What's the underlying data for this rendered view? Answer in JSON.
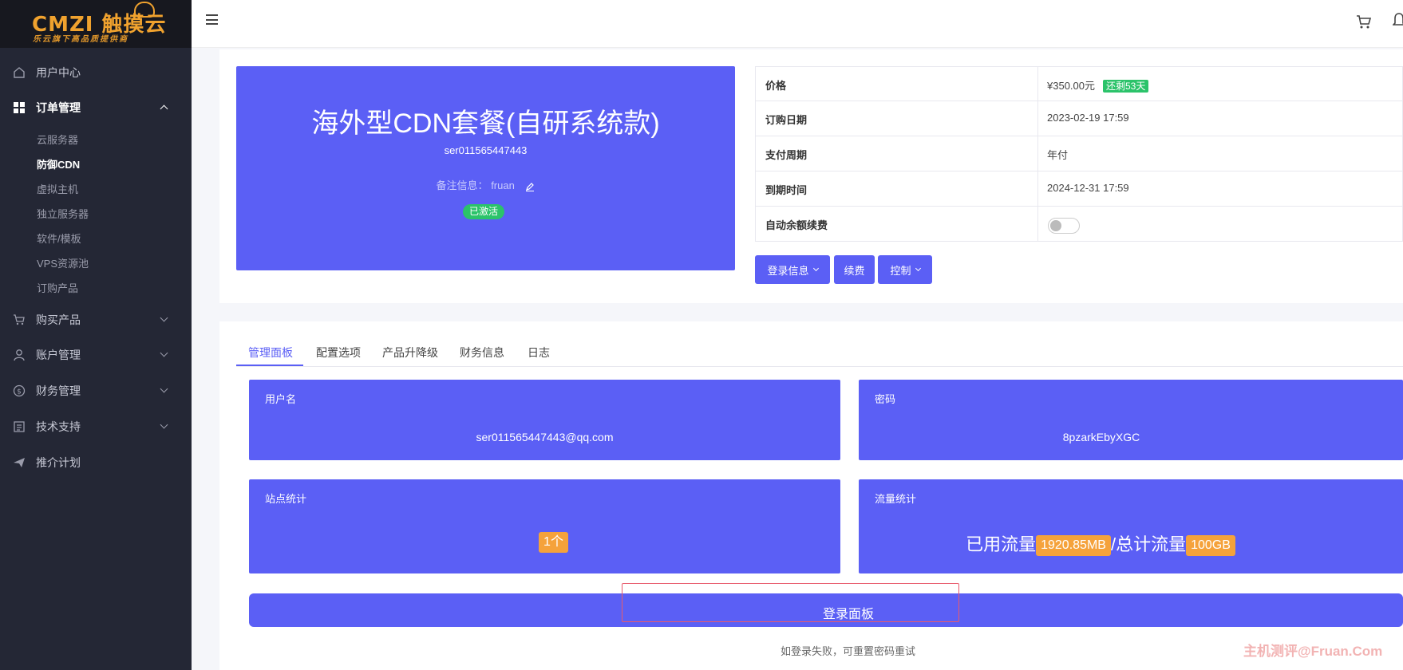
{
  "logo": {
    "brand": "CMZI 触摸云",
    "tagline": "乐云旗下高品质提供商"
  },
  "sidebar": {
    "items": [
      {
        "label": "用户中心",
        "icon": "home-icon"
      },
      {
        "label": "订单管理",
        "icon": "grid-icon",
        "expanded": true,
        "children": [
          "云服务器",
          "防御CDN",
          "虚拟主机",
          "独立服务器",
          "软件/模板",
          "VPS资源池",
          "订购产品"
        ],
        "active_child": "防御CDN"
      },
      {
        "label": "购买产品",
        "icon": "cart-icon"
      },
      {
        "label": "账户管理",
        "icon": "user-icon"
      },
      {
        "label": "财务管理",
        "icon": "dollar-icon"
      },
      {
        "label": "技术支持",
        "icon": "document-icon"
      },
      {
        "label": "推介计划",
        "icon": "paper-plane-icon"
      }
    ]
  },
  "product": {
    "title": "海外型CDN套餐(自研系统款)",
    "id": "ser011565447443",
    "note_label": "备注信息：",
    "note_value": "fruan",
    "status": "已激活"
  },
  "info": {
    "price_label": "价格",
    "price_value": "¥350.00元",
    "remain": "还剩53天",
    "order_date_label": "订购日期",
    "order_date_value": "2023-02-19 17:59",
    "cycle_label": "支付周期",
    "cycle_value": "年付",
    "expire_label": "到期时间",
    "expire_value": "2024-12-31 17:59",
    "auto_renew_label": "自动余额续费",
    "auto_renew_on": false
  },
  "actions": {
    "login_info": "登录信息",
    "renew": "续费",
    "control": "控制"
  },
  "tabs": [
    "管理面板",
    "配置选项",
    "产品升降级",
    "财务信息",
    "日志"
  ],
  "panels": {
    "username_title": "用户名",
    "username_value": "ser011565447443@qq.com",
    "password_title": "密码",
    "password_value": "8pzarkEbyXGC",
    "sites_title": "站点统计",
    "sites_value": "1个",
    "traffic_title": "流量统计",
    "traffic_used_label": "已用流量",
    "traffic_used_value": "1920.85MB",
    "traffic_sep": "/",
    "traffic_total_label": "总计流量",
    "traffic_total_value": "100GB"
  },
  "login_panel_button": "登录面板",
  "hint": "如登录失败，可重置密码重试",
  "watermark": "主机测评@Fruan.Com",
  "colors": {
    "sidebar_bg": "#242735",
    "accent": "#5b5ff5",
    "success": "#2bc36a",
    "highlight": "#f5a23b"
  }
}
